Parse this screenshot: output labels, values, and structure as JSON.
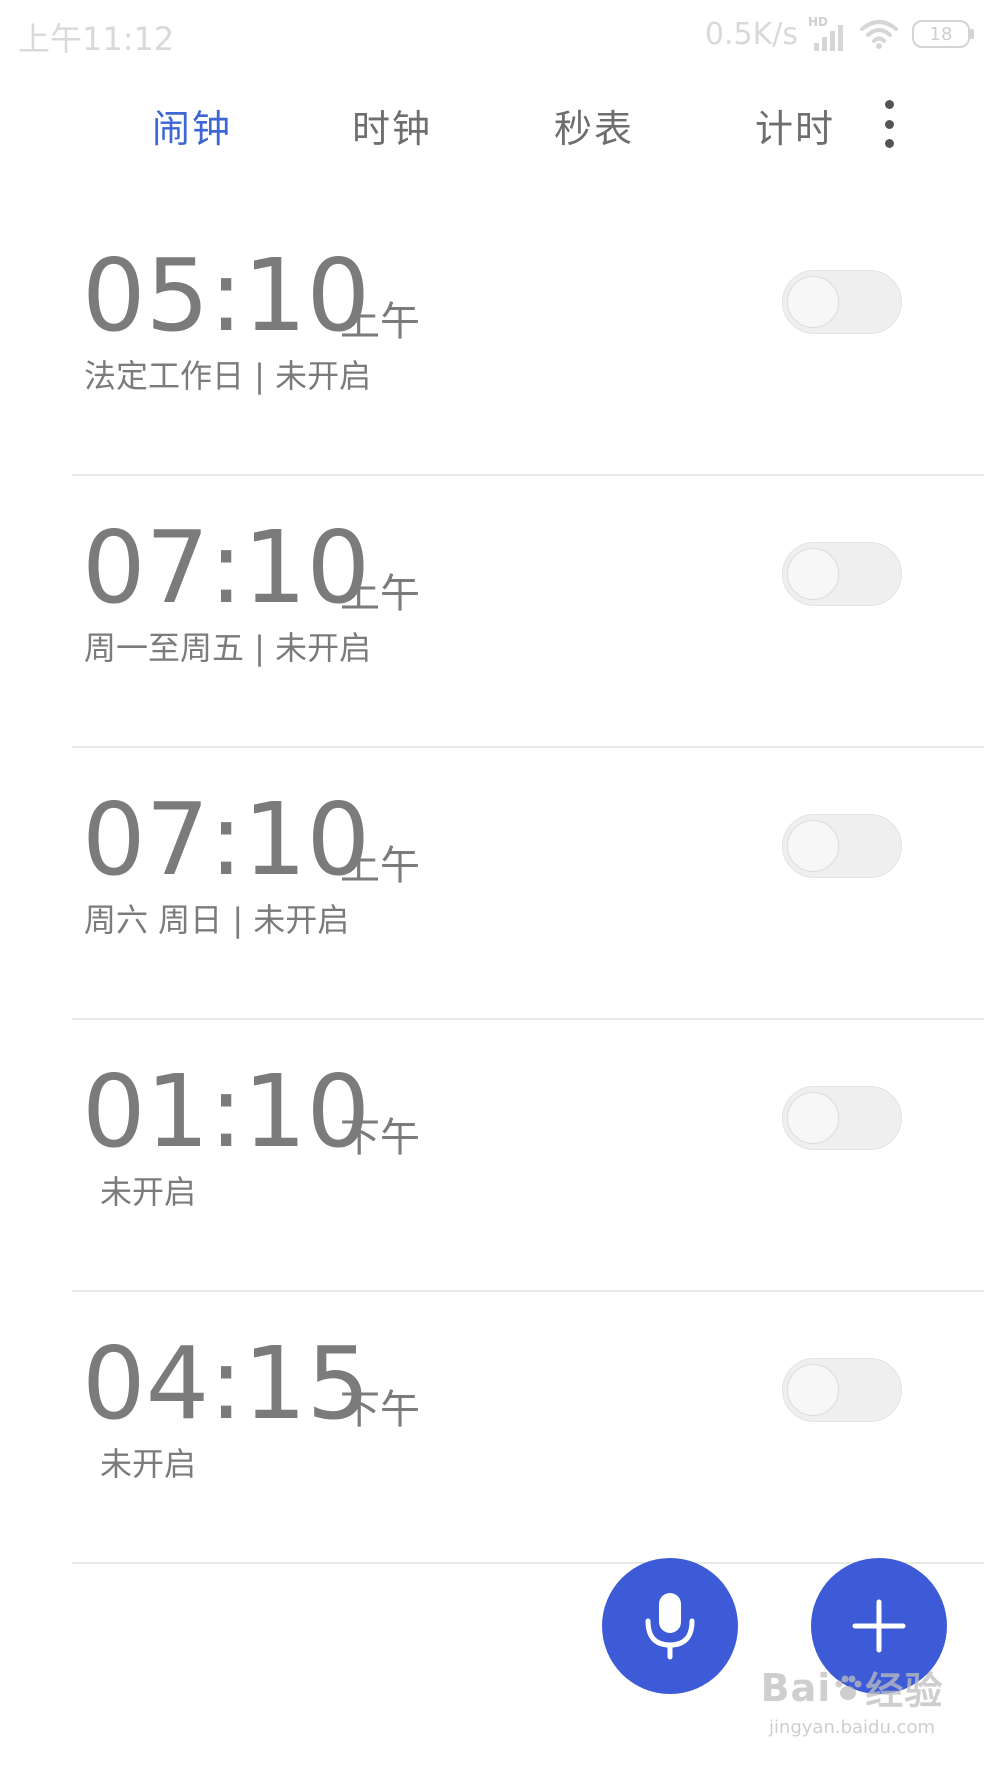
{
  "status_bar": {
    "time": "上午11:12",
    "net_speed": "0.5K/s",
    "signal_label": "HD",
    "battery": "18"
  },
  "tabs": [
    {
      "label": "闹钟",
      "active": true
    },
    {
      "label": "时钟",
      "active": false
    },
    {
      "label": "秒表",
      "active": false
    },
    {
      "label": "计时",
      "active": false
    }
  ],
  "alarms": [
    {
      "time": "05:10",
      "period": "上午",
      "desc": "法定工作日 | 未开启",
      "enabled": false
    },
    {
      "time": "07:10",
      "period": "上午",
      "desc": "周一至周五 | 未开启",
      "enabled": false
    },
    {
      "time": "07:10",
      "period": "上午",
      "desc": "周六 周日 | 未开启",
      "enabled": false
    },
    {
      "time": "01:10",
      "period": "下午",
      "desc": "未开启",
      "enabled": false
    },
    {
      "time": "04:15",
      "period": "下午",
      "desc": "未开启",
      "enabled": false
    }
  ],
  "fab": {
    "mic_icon": "microphone-icon",
    "add_icon": "plus-icon"
  },
  "watermark": {
    "logo_left": "Bai",
    "logo_right": "经验",
    "url": "jingyan.baidu.com"
  },
  "colors": {
    "accent": "#3d66d6",
    "fab": "#3d5bd6",
    "text": "#7b7b7b"
  }
}
